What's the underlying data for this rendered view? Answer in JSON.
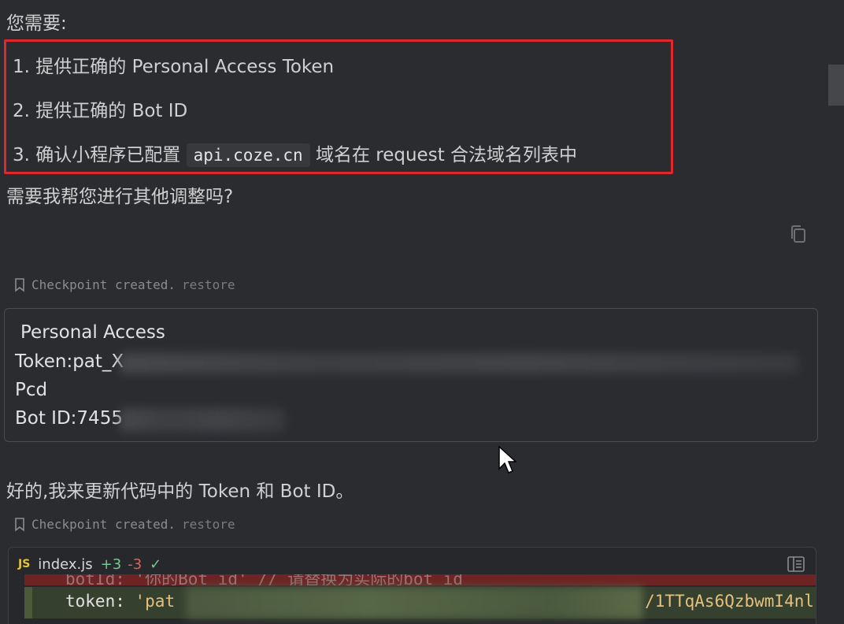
{
  "chat": {
    "intro": "您需要:",
    "steps": [
      {
        "prefix": "1. 提供正确的 Personal Access Token"
      },
      {
        "prefix": "2. 提供正确的 Bot ID"
      },
      {
        "prefix": "3. 确认小程序已配置 ",
        "code": "api.coze.cn",
        "suffix": " 域名在 request 合法域名列表中"
      }
    ],
    "question": "需要我帮您进行其他调整吗?",
    "checkpoint1": {
      "text": "Checkpoint created.",
      "restore": "restore"
    },
    "user_message": {
      "line1": "Personal Access",
      "line2": "Token:pat_X",
      "line3": "Pcd",
      "line4": "Bot ID:7455"
    },
    "reply": "好的,我来更新代码中的 Token 和 Bot ID。",
    "checkpoint2": {
      "text": "Checkpoint created.",
      "restore": "restore"
    }
  },
  "code_block": {
    "badge": "JS",
    "file_name": "index.js",
    "adds": "+3",
    "dels": "-3",
    "check": "✓",
    "removed_line": "botId: '你的Bot_id' // 请替换为实际的bot_id",
    "added_key": "token: ",
    "added_value_start": "'pat",
    "added_value_tail": "/1TTqAs6QzbwmI4nl"
  },
  "icons": {
    "copy": "copy-icon",
    "bookmark": "bookmark-icon",
    "panel": "panel-icon",
    "cursor": "mouse-cursor-icon"
  },
  "colors": {
    "background": "#2b2c30",
    "highlight_border": "#e0272b",
    "added": "#73c991",
    "removed": "#e0605a"
  }
}
